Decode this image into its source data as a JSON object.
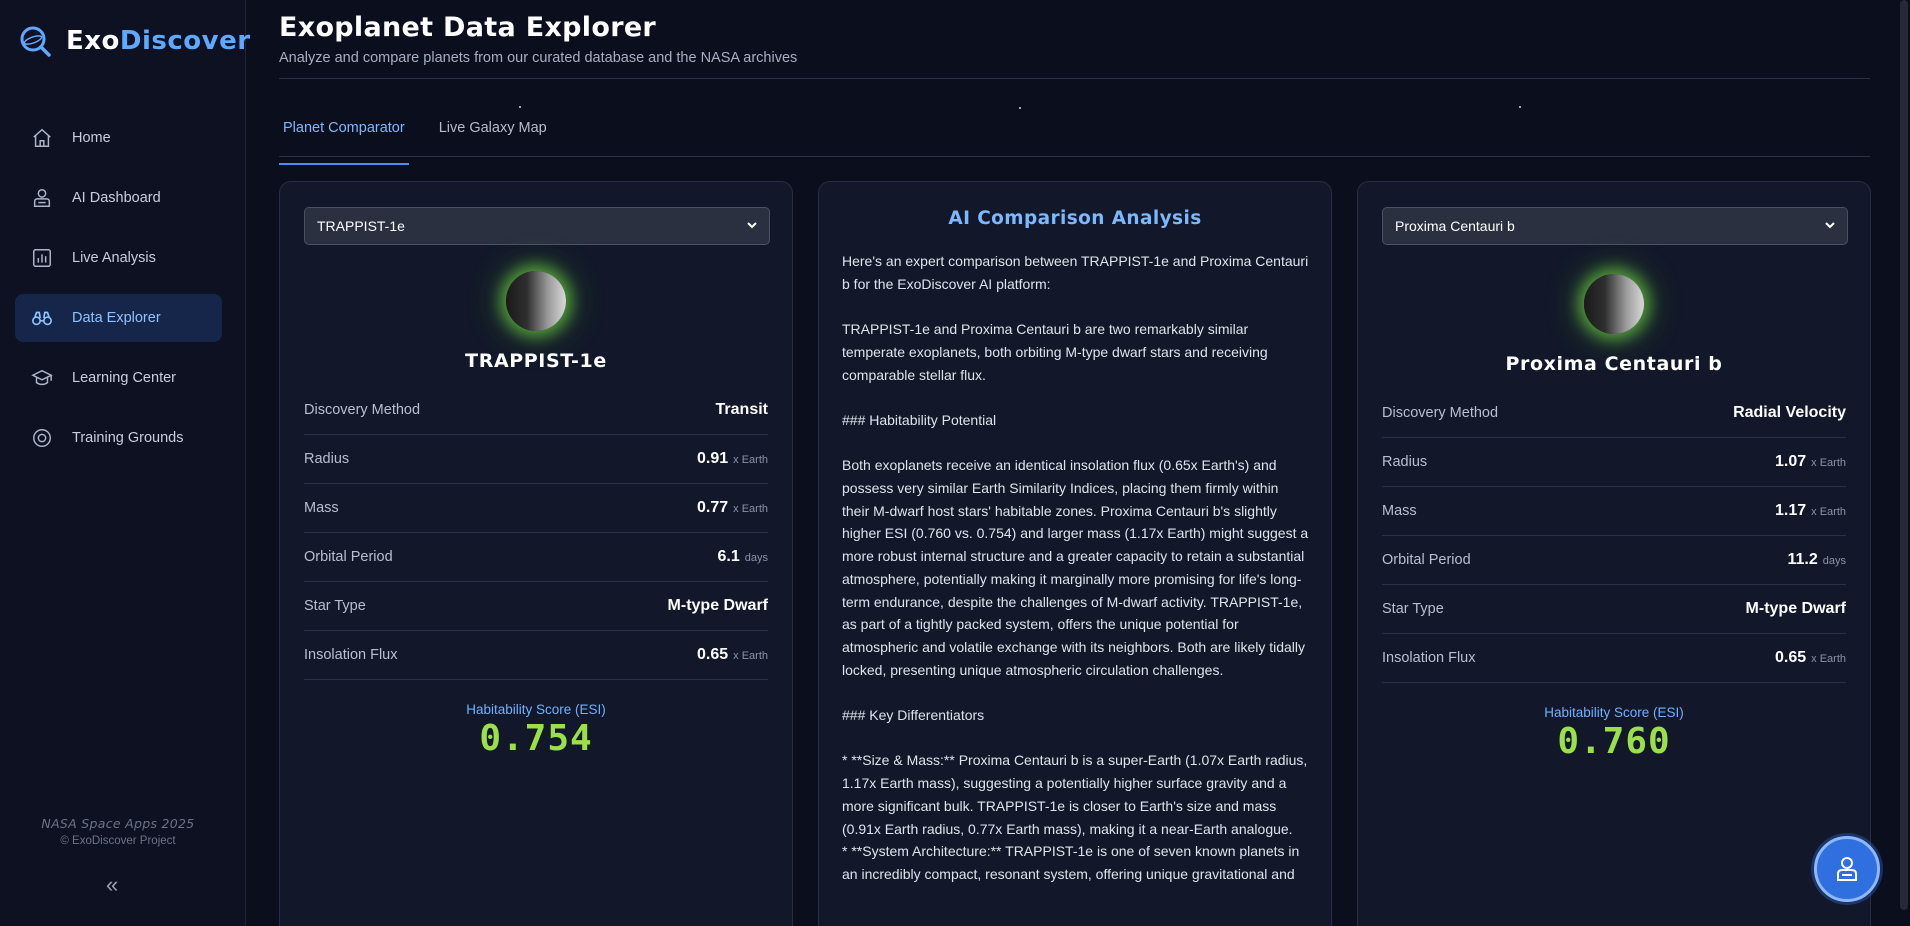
{
  "brand": {
    "part1": "Exo",
    "part2": "Discover"
  },
  "nav": [
    {
      "label": "Home",
      "icon": "home-icon",
      "active": false
    },
    {
      "label": "AI Dashboard",
      "icon": "robot-icon",
      "active": false
    },
    {
      "label": "Live Analysis",
      "icon": "bar-chart-icon",
      "active": false
    },
    {
      "label": "Data Explorer",
      "icon": "binoculars-icon",
      "active": true
    },
    {
      "label": "Learning Center",
      "icon": "graduation-cap-icon",
      "active": false
    },
    {
      "label": "Training Grounds",
      "icon": "target-icon",
      "active": false
    }
  ],
  "footer": {
    "line1": "NASA Space Apps 2025",
    "line2": "© ExoDiscover Project",
    "collapse": "«"
  },
  "header": {
    "title": "Exoplanet Data Explorer",
    "subtitle": "Analyze and compare planets from our curated database and the NASA archives"
  },
  "tabs": [
    {
      "label": "Planet Comparator",
      "active": true
    },
    {
      "label": "Live Galaxy Map",
      "active": false
    }
  ],
  "left_planet": {
    "selected": "TRAPPIST-1e",
    "name": "TRAPPIST-1e",
    "stats": [
      {
        "label": "Discovery Method",
        "value": "Transit",
        "unit": ""
      },
      {
        "label": "Radius",
        "value": "0.91",
        "unit": "x Earth"
      },
      {
        "label": "Mass",
        "value": "0.77",
        "unit": "x Earth"
      },
      {
        "label": "Orbital Period",
        "value": "6.1",
        "unit": "days"
      },
      {
        "label": "Star Type",
        "value": "M-type Dwarf",
        "unit": ""
      },
      {
        "label": "Insolation Flux",
        "value": "0.65",
        "unit": "x Earth"
      }
    ],
    "esi_label": "Habitability Score (ESI)",
    "esi_value": "0.754"
  },
  "right_planet": {
    "selected": "Proxima Centauri b",
    "name": "Proxima Centauri b",
    "stats": [
      {
        "label": "Discovery Method",
        "value": "Radial Velocity",
        "unit": ""
      },
      {
        "label": "Radius",
        "value": "1.07",
        "unit": "x Earth"
      },
      {
        "label": "Mass",
        "value": "1.17",
        "unit": "x Earth"
      },
      {
        "label": "Orbital Period",
        "value": "11.2",
        "unit": "days"
      },
      {
        "label": "Star Type",
        "value": "M-type Dwarf",
        "unit": ""
      },
      {
        "label": "Insolation Flux",
        "value": "0.65",
        "unit": "x Earth"
      }
    ],
    "esi_label": "Habitability Score (ESI)",
    "esi_value": "0.760"
  },
  "analysis": {
    "title": "AI Comparison Analysis",
    "paragraphs": [
      "Here's an expert comparison between TRAPPIST-1e and Proxima Centauri b for the ExoDiscover AI platform:",
      "TRAPPIST-1e and Proxima Centauri b are two remarkably similar temperate exoplanets, both orbiting M-type dwarf stars and receiving comparable stellar flux.",
      "### Habitability Potential",
      "Both exoplanets receive an identical insolation flux (0.65x Earth's) and possess very similar Earth Similarity Indices, placing them firmly within their M-dwarf host stars' habitable zones. Proxima Centauri b's slightly higher ESI (0.760 vs. 0.754) and larger mass (1.17x Earth) might suggest a more robust internal structure and a greater capacity to retain a substantial atmosphere, potentially making it marginally more promising for life's long-term endurance, despite the challenges of M-dwarf activity. TRAPPIST-1e, as part of a tightly packed system, offers the unique potential for atmospheric and volatile exchange with its neighbors. Both are likely tidally locked, presenting unique atmospheric circulation challenges.",
      "### Key Differentiators",
      "*   **Size & Mass:** Proxima Centauri b is a super-Earth (1.07x Earth radius, 1.17x Earth mass), suggesting a potentially higher surface gravity and a more significant bulk. TRAPPIST-1e is closer to Earth's size and mass (0.91x Earth radius, 0.77x Earth mass), making it a near-Earth analogue.\n*   **System Architecture:** TRAPPIST-1e is one of seven known planets in an incredibly compact, resonant system, offering unique gravitational and"
    ]
  },
  "colors": {
    "accent": "#5ea8ff",
    "esi": "#9be04a",
    "background": "#0b0e1d",
    "panel": "#121829"
  }
}
